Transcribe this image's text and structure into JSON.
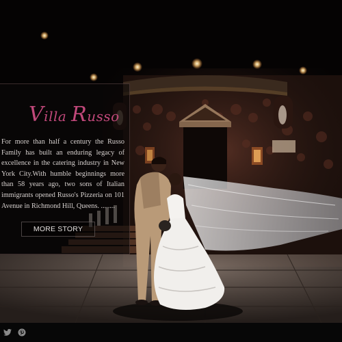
{
  "brand": {
    "logo_text": "Villa Russo",
    "logo_color": "#c0487a"
  },
  "about": {
    "text": "For more than half a century the Russo Family has built an enduring legacy of excellence in the catering industry in New York City.With humble beginnings more than 58 years ago, two sons of Italian immigrants opened Russo's Pizzeria on 101 Avenue in Richmond Hill, Queens. ........",
    "button_label": "MORE STORY"
  },
  "social": {
    "icons": [
      "twitter-icon",
      "pinterest-icon"
    ]
  },
  "colors": {
    "background": "#060404",
    "panel": "#0c0808",
    "text": "#d8d2d0"
  }
}
